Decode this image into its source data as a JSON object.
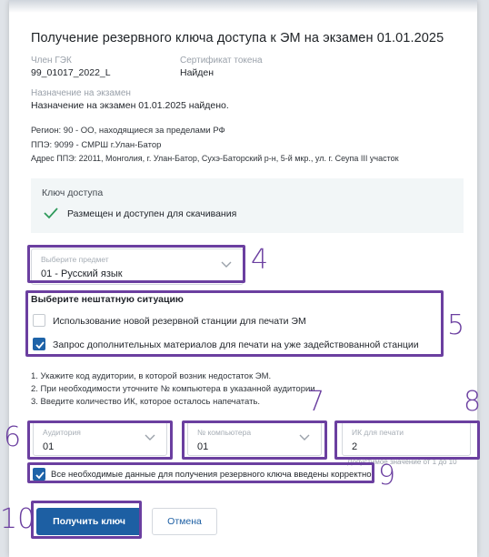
{
  "dialog": {
    "title": "Получение резервного ключа доступа к ЭМ на экзамен 01.01.2025",
    "member_label": "Член ГЭК",
    "member_value": "99_01017_2022_L",
    "cert_label": "Сертификат токена",
    "cert_value": "Найден",
    "assign_label": "Назначение на экзамен",
    "assign_value": "Назначение на экзамен 01.01.2025 найдено.",
    "region": "Регион: 90 - ОО, находящиеся за пределами РФ",
    "ppe": "ППЭ: 9099 - СМРШ г.Улан-Батор",
    "address": "Адрес ППЭ: 22011, Монголия, г. Улан-Батор, Сухэ-Баторский р-н, 5-й мкр., ул. г. Сеупа III участок"
  },
  "access_key": {
    "label": "Ключ доступа",
    "status": "Размещен и доступен для скачивания"
  },
  "subject": {
    "label": "Выберите предмет",
    "value": "01 - Русский язык"
  },
  "situation": {
    "title": "Выберите нештатную ситуацию",
    "options": [
      {
        "label": "Использование новой резервной станции для печати ЭМ",
        "checked": false
      },
      {
        "label": "Запрос дополнительных материалов для печати на уже задействованной станции",
        "checked": true
      }
    ]
  },
  "instructions": [
    "1. Укажите код аудитории, в которой возник недостаток ЭМ.",
    "2. При необходимости уточните № компьютера в указанной аудитории.",
    "3. Введите количество ИК, которое осталось напечатать."
  ],
  "auditorium": {
    "label": "Аудитория",
    "value": "01"
  },
  "computer": {
    "label": "№ компьютера",
    "value": "01"
  },
  "ik_count": {
    "label": "ИК для печати",
    "value": "2",
    "hint": "Допустимое значение от 1 до 10"
  },
  "confirm": {
    "label": "Все необходимые данные для получения резервного ключа введены корректно",
    "checked": true
  },
  "buttons": {
    "primary": "Получить ключ",
    "secondary": "Отмена"
  },
  "annotations": [
    "4",
    "5",
    "6",
    "7",
    "8",
    "9",
    "10"
  ],
  "colors": {
    "accent": "#1d5fa3",
    "annotation": "#6b3fa0",
    "keybox_bg": "#f2f6f7"
  }
}
